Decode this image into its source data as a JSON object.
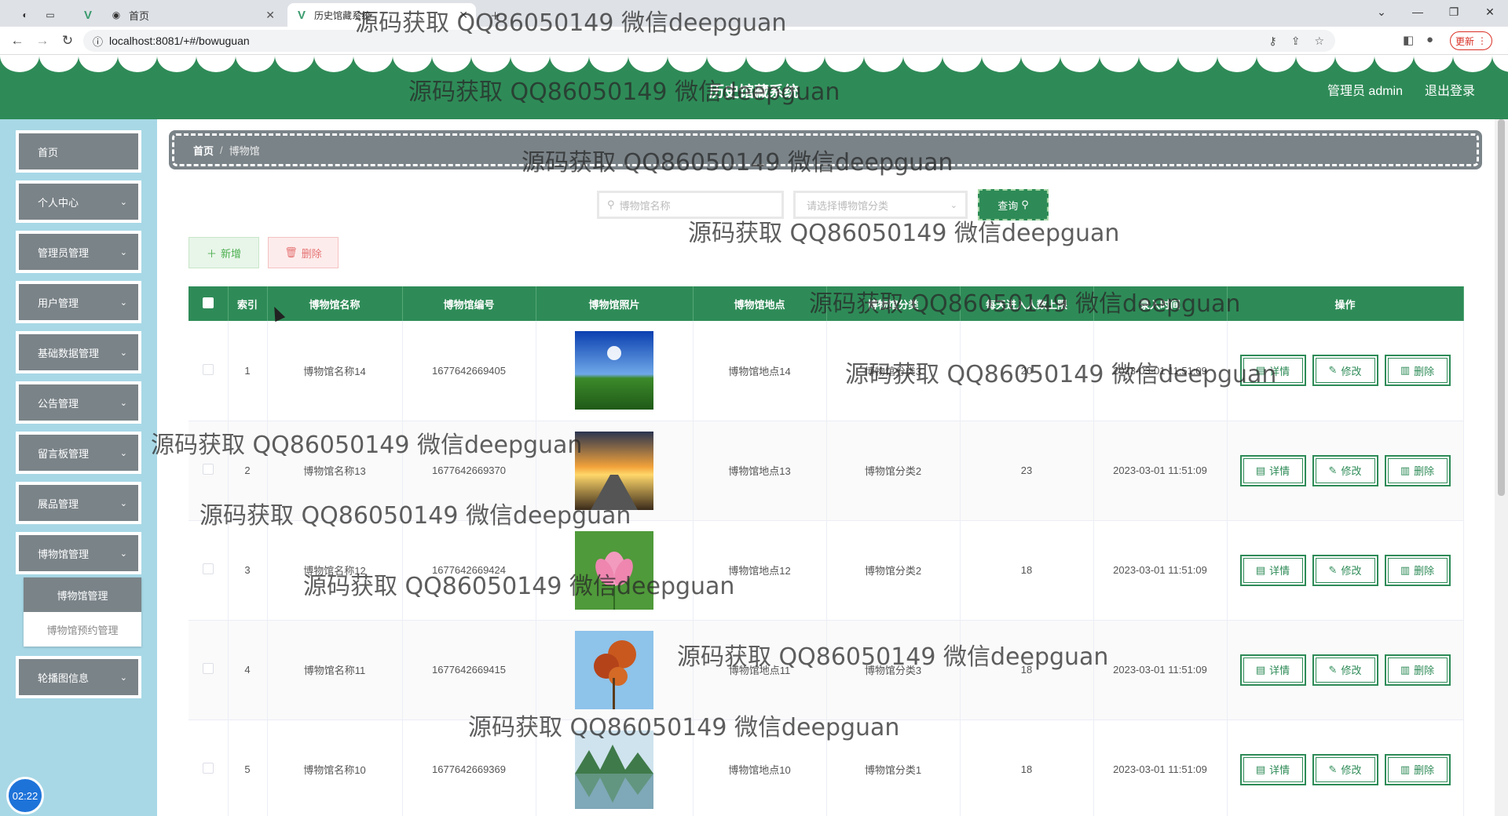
{
  "browser": {
    "tabs": [
      {
        "label": "首页",
        "active": false
      },
      {
        "label": "历史馆藏系统",
        "active": true
      }
    ],
    "url": "localhost:8081/+#/bowuguan",
    "update_label": "更新"
  },
  "header": {
    "title": "历史馆藏系统",
    "user": "管理员 admin",
    "logout": "退出登录"
  },
  "sidebar": {
    "items": [
      {
        "label": "首页",
        "has_chevron": false
      },
      {
        "label": "个人中心",
        "has_chevron": true
      },
      {
        "label": "管理员管理",
        "has_chevron": true
      },
      {
        "label": "用户管理",
        "has_chevron": true
      },
      {
        "label": "基础数据管理",
        "has_chevron": true
      },
      {
        "label": "公告管理",
        "has_chevron": true
      },
      {
        "label": "留言板管理",
        "has_chevron": true
      },
      {
        "label": "展品管理",
        "has_chevron": true
      },
      {
        "label": "博物馆管理",
        "has_chevron": true
      },
      {
        "label": "轮播图信息",
        "has_chevron": true
      }
    ],
    "submenu": [
      {
        "label": "博物馆管理",
        "active": true
      },
      {
        "label": "博物馆预约管理",
        "active": false
      }
    ],
    "clock": "02:22"
  },
  "breadcrumb": {
    "home": "首页",
    "separator": "/",
    "current": "博物馆"
  },
  "search": {
    "name_placeholder": "博物馆名称",
    "category_placeholder": "请选择博物馆分类",
    "query_label": "查询"
  },
  "actions": {
    "add_label": "新增",
    "delete_label": "删除"
  },
  "table": {
    "columns": [
      "索引",
      "博物馆名称",
      "博物馆编号",
      "博物馆照片",
      "博物馆地点",
      "博物馆分类",
      "每天进入人数上限",
      "录入时间",
      "操作"
    ],
    "rows": [
      {
        "index": "1",
        "name": "博物馆名称14",
        "code": "1677642669405",
        "photo": "meadow-sky",
        "location": "博物馆地点14",
        "category": "博物馆分类3",
        "limit": "20",
        "time": "2023-03-01 11:51:09"
      },
      {
        "index": "2",
        "name": "博物馆名称13",
        "code": "1677642669370",
        "photo": "sunset-road",
        "location": "博物馆地点13",
        "category": "博物馆分类2",
        "limit": "23",
        "time": "2023-03-01 11:51:09"
      },
      {
        "index": "3",
        "name": "博物馆名称12",
        "code": "1677642669424",
        "photo": "lotus-flower",
        "location": "博物馆地点12",
        "category": "博物馆分类2",
        "limit": "18",
        "time": "2023-03-01 11:51:09"
      },
      {
        "index": "4",
        "name": "博物馆名称11",
        "code": "1677642669415",
        "photo": "autumn-leaves",
        "location": "博物馆地点11",
        "category": "博物馆分类3",
        "limit": "18",
        "time": "2023-03-01 11:51:09"
      },
      {
        "index": "5",
        "name": "博物馆名称10",
        "code": "1677642669369",
        "photo": "lake-mountains",
        "location": "博物馆地点10",
        "category": "博物馆分类1",
        "limit": "18",
        "time": "2023-03-01 11:51:09"
      }
    ],
    "row_actions": {
      "detail": "详情",
      "edit": "修改",
      "delete": "删除"
    }
  },
  "watermark": "源码获取 QQ86050149 微信deepguan",
  "colors": {
    "primary": "#2e8b57",
    "sidebar_bg": "#a8d8e6",
    "menu_item": "#7a8388"
  }
}
